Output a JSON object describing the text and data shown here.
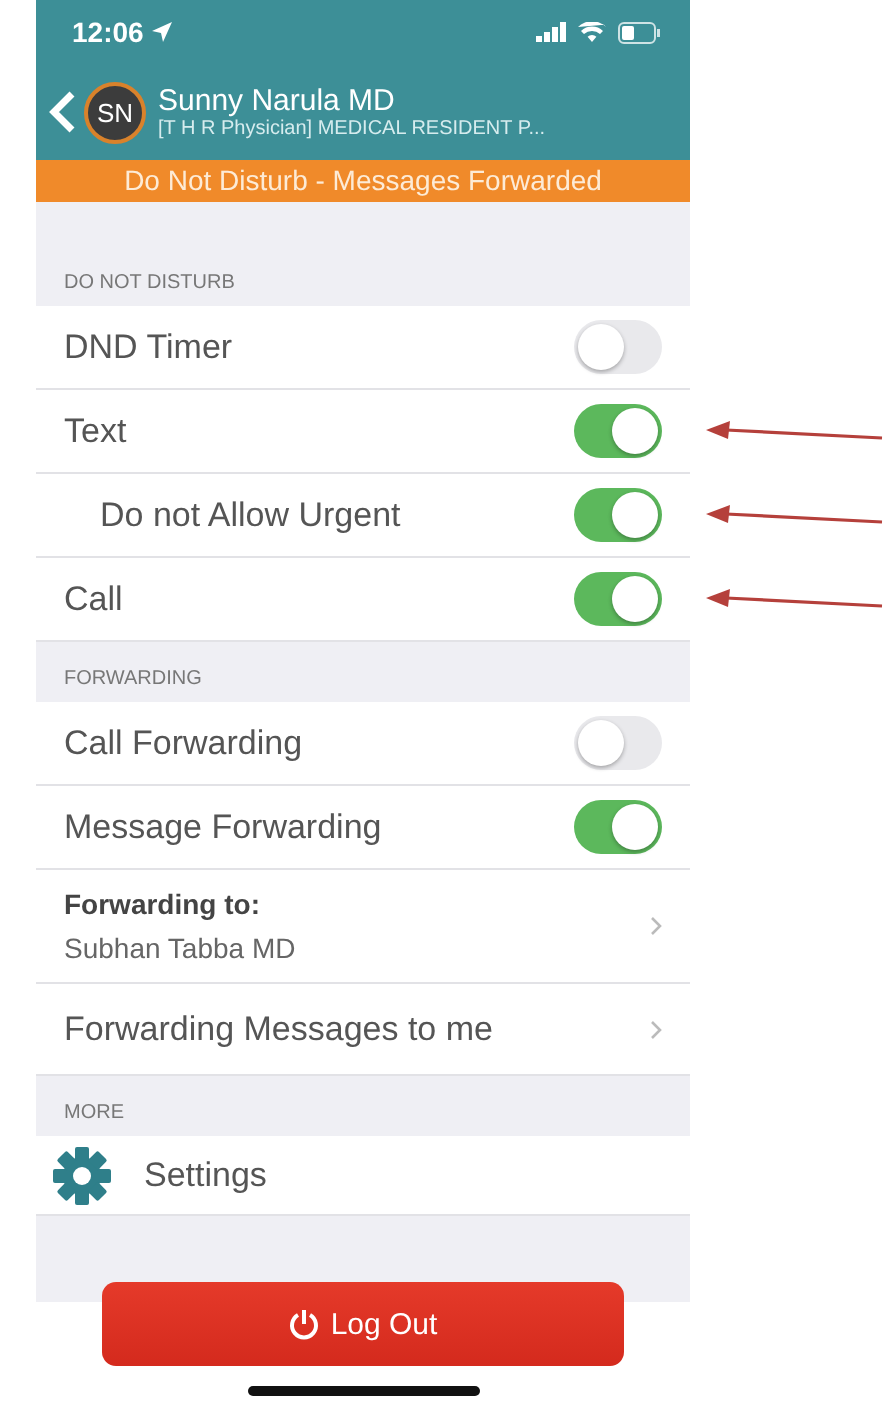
{
  "status_bar": {
    "time": "12:06"
  },
  "header": {
    "initials": "SN",
    "name": "Sunny Narula MD",
    "subtitle": "[T H R Physician] MEDICAL RESIDENT P..."
  },
  "banner": "Do Not Disturb - Messages Forwarded",
  "sections": [
    {
      "title": "DO NOT DISTURB",
      "rows": [
        {
          "kind": "toggle",
          "label": "DND Timer",
          "on": false,
          "indented": false,
          "marked": false
        },
        {
          "kind": "toggle",
          "label": "Text",
          "on": true,
          "indented": false,
          "marked": true
        },
        {
          "kind": "toggle",
          "label": "Do not Allow Urgent",
          "on": true,
          "indented": true,
          "marked": true
        },
        {
          "kind": "toggle",
          "label": "Call",
          "on": true,
          "indented": false,
          "marked": true
        }
      ]
    },
    {
      "title": "FORWARDING",
      "rows": [
        {
          "kind": "toggle",
          "label": "Call Forwarding",
          "on": false,
          "indented": false,
          "marked": false
        },
        {
          "kind": "toggle",
          "label": "Message Forwarding",
          "on": true,
          "indented": false,
          "marked": false
        },
        {
          "kind": "detail",
          "label": "Forwarding to:",
          "value": "Subhan Tabba MD"
        },
        {
          "kind": "link",
          "label": "Forwarding Messages to me"
        }
      ]
    },
    {
      "title": "MORE",
      "rows": [
        {
          "kind": "settings",
          "label": "Settings"
        }
      ]
    }
  ],
  "logout": "Log Out"
}
